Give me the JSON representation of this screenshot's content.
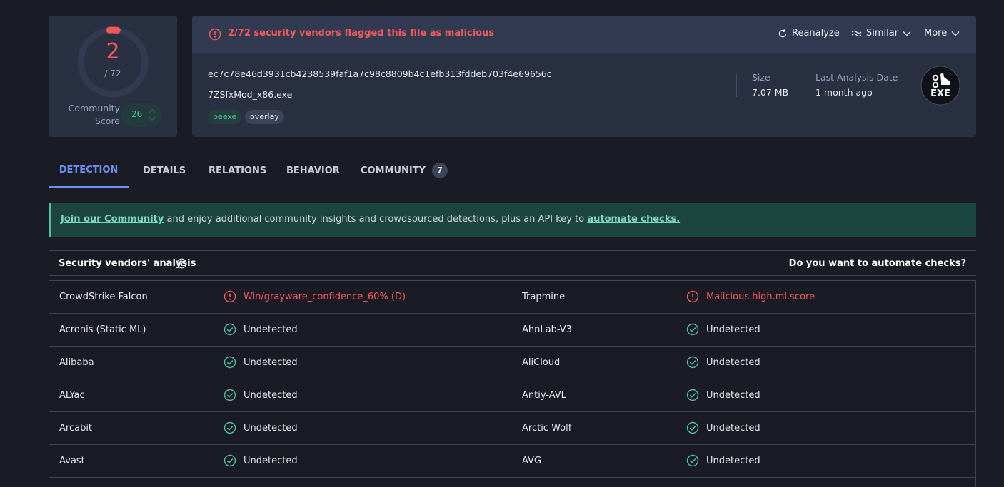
{
  "score": {
    "detections": "2",
    "total": "/ 72"
  },
  "community": {
    "label": "Community Score",
    "value": "26"
  },
  "file": {
    "alert": "2/72 security vendors flagged this file as malicious",
    "actions": {
      "reanalyze": "Reanalyze",
      "similar": "Similar",
      "more": "More"
    },
    "hash": "ec7c78e46d3931cb4238539faf1a7c98c8809b4c1efb313fddeb703f4e69656c",
    "name": "7ZSfxMod_x86.exe",
    "tags": [
      "peexe",
      "overlay"
    ],
    "size_label": "Size",
    "size_value": "7.07 MB",
    "date_label": "Last Analysis Date",
    "date_value": "1 month ago",
    "type_badge": "EXE"
  },
  "tabs": [
    {
      "label": "DETECTION",
      "active": true
    },
    {
      "label": "DETAILS"
    },
    {
      "label": "RELATIONS"
    },
    {
      "label": "BEHAVIOR"
    },
    {
      "label": "COMMUNITY",
      "badge": "7"
    }
  ],
  "banner": {
    "link1": "Join our Community",
    "text": " and enjoy additional community insights and crowdsourced detections, plus an API key to ",
    "link2": "automate checks."
  },
  "vendors": {
    "title": "Security vendors' analysis",
    "automate": "Do you want to automate checks?",
    "rows": [
      [
        {
          "name": "CrowdStrike Falcon",
          "result": "Win/grayware_confidence_60% (D)",
          "malicious": true
        },
        {
          "name": "Trapmine",
          "result": "Malicious.high.ml.score",
          "malicious": true
        }
      ],
      [
        {
          "name": "Acronis (Static ML)",
          "result": "Undetected"
        },
        {
          "name": "AhnLab-V3",
          "result": "Undetected"
        }
      ],
      [
        {
          "name": "Alibaba",
          "result": "Undetected"
        },
        {
          "name": "AliCloud",
          "result": "Undetected"
        }
      ],
      [
        {
          "name": "ALYac",
          "result": "Undetected"
        },
        {
          "name": "Antiy-AVL",
          "result": "Undetected"
        }
      ],
      [
        {
          "name": "Arcabit",
          "result": "Undetected"
        },
        {
          "name": "Arctic Wolf",
          "result": "Undetected"
        }
      ],
      [
        {
          "name": "Avast",
          "result": "Undetected"
        },
        {
          "name": "AVG",
          "result": "Undetected"
        }
      ]
    ]
  },
  "colors": {
    "malicious": "#f25a5a",
    "clean": "#4dc1a1",
    "accent": "#6f8ff0"
  }
}
